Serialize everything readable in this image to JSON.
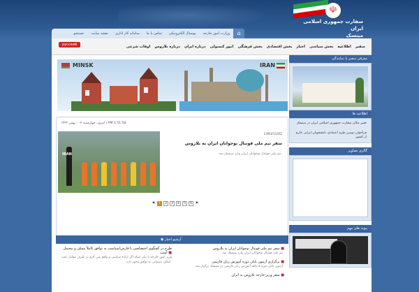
{
  "header": {
    "title_line1": "سفارت جمهوری اسلامی ایران",
    "title_line2": "مینسک",
    "flag_colors": [
      "#239f40",
      "#ffffff",
      "#da0000"
    ]
  },
  "topnav": {
    "items": [
      "وزارت امور خارجه",
      "پوستال الکترونیکی",
      "تماس با ما",
      "سامانه کار اداری",
      "نقشه سایت",
      "جستجو"
    ]
  },
  "mainnav": {
    "items": [
      "سفیر",
      "اطلاعیه",
      "بخش سیاسی",
      "اخبار",
      "بخش اقتصادی",
      "بخش فرهنگی",
      "امور کنسولی",
      "درباره ایران",
      "درباره بلاروس",
      "اوقات شرعی"
    ],
    "lang_button": "русский"
  },
  "slider": {
    "left_label": "MINSK",
    "right_label": "IRAN"
  },
  "news": {
    "current_date": "امروز: چهارشنبه ۰۴ - بهمن ۱۳۹۳ | PM 1:51:58",
    "date": "1393/11/02",
    "title": "سفر تیم ملی فوتبال نوجوانان ایران به بلاروس",
    "summary": "تیم ملی فوتبال نوجوانان ایران وارد مینسک شد.",
    "image_badge": "IRAN",
    "pages": [
      "1",
      "2",
      "3",
      "4",
      "5",
      "6"
    ],
    "active_page": "1"
  },
  "archive": {
    "header": "آرشیو اخبار",
    "right_items": [
      {
        "title": "سفر تیم ملی فوتبال نوجوانان ایران به بلاروس",
        "sub": "تیم ملی فوتبال نوجوانان ایران وارد مینسک شد."
      },
      {
        "title": "برگزاری آزمون پایان دوره آموزش زبان فارسی",
        "sub": "آزمون پایان دوره ۵ ماهه آموزش زبان فارسی در مینسک برگزار شد."
      },
      {
        "title": "سفر وزیر خارجه بلاروس به ایران",
        "sub": ""
      }
    ],
    "left_items": [
      {
        "title": "طرح در گفتگوی اختصاصی با فارس/سیاست به توافق کاملاً ممکن و محتمل است",
        "sub": "وزیر امور خارجه با بیان اینکه اگر اراده سیاسی و واقع بینی لازم در طرف مقابل باشد امکان دستیابی به توافق وجود دارد."
      }
    ]
  },
  "sidebar": {
    "ambassador_header": "معرفی سفیر یا نمایندگی",
    "notices_header": "اطلاعیه ها",
    "notice_text": "تغییر مکان سفارت جمهوری اسلامی ایران در مینسک",
    "notice_links": "فراخوان   دومین   طرح   اعتمادی دانشجویان ایرانی خارج از کشور",
    "gallery_header": "گالری تصاویر",
    "links_header": "پیوند های مهم"
  }
}
